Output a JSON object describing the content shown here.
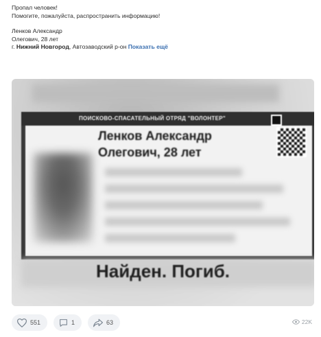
{
  "post": {
    "lines": [
      "Пропал человек!",
      "Помогите, пожалуйста, распространить информацию!"
    ],
    "person_name": "Ленков Александр",
    "person_age": "Олегович, 28 лет",
    "location_prefix": "г. ",
    "location_city": "Нижний Новгород",
    "location_rest": ", Автозаводский р-он",
    "show_more": "Показать ещё"
  },
  "image": {
    "org_name": "ПОИСКОВО-СПАСАТЕЛЬНЫЙ ОТРЯД \"ВОЛОНТЕР\"",
    "name_line1": "Ленков Александр",
    "name_line2": "Олегович, 28 лет",
    "status": "Найден. Погиб."
  },
  "actions": {
    "likes": "551",
    "comments": "1",
    "shares": "63",
    "views": "22K"
  },
  "colors": {
    "link": "#3a6fb0",
    "pill_bg": "#f0f2f5",
    "icon": "#7a8591"
  }
}
